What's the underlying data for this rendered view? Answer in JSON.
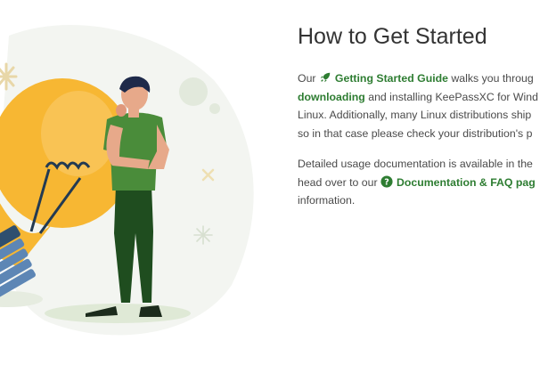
{
  "heading": "How to Get Started",
  "p1": {
    "t1": "Our",
    "link1": "Getting Started Guide",
    "t2": "walks you throug",
    "link2": "downloading",
    "t3": "and installing KeePassXC for Wind",
    "t4": "Linux. Additionally, many Linux distributions ship",
    "t5": "so in that case please check your distribution's p"
  },
  "p2": {
    "t1": "Detailed usage documentation is available in the",
    "t2": "head over to our",
    "link": "Documentation & FAQ pag",
    "t3": "information."
  },
  "icons": {
    "rocket": "rocket-icon",
    "question": "question-circle-icon"
  },
  "colors": {
    "link": "#2e7d32",
    "shirt": "#4a8c3a",
    "pants": "#1f4d1f",
    "bulb": "#f7b733"
  }
}
